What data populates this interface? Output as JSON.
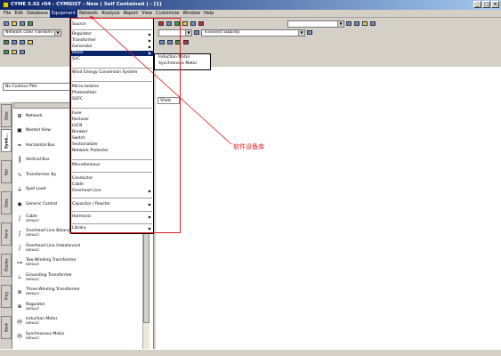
{
  "window": {
    "title": "CYME 5.02 r04 - CYMDIST - New ( Self Contained ) - [1]",
    "min": "_",
    "max": "□",
    "close": "×"
  },
  "menubar": [
    "File",
    "Edit",
    "Database",
    "Equipment",
    "Network",
    "Analysis",
    "Report",
    "View",
    "Customize",
    "Window",
    "Help"
  ],
  "toolbar": {
    "network_color": "Network color (random)",
    "transient": "Transient Stability"
  },
  "contour": "No Contour Plot",
  "view_tab": "View",
  "tabs": [
    "Data",
    "Symb...",
    "Net",
    "Data",
    "Anno",
    "Display",
    "Prog",
    "Book"
  ],
  "equipment_menu": {
    "items": [
      {
        "label": "Source",
        "sub": false
      },
      {
        "label": "Regulator",
        "sub": true
      },
      {
        "label": "Transformer",
        "sub": true
      },
      {
        "label": "Generator",
        "sub": true
      },
      {
        "label": "Motor",
        "sub": true,
        "highlight": true
      },
      {
        "label": "SVC",
        "sub": false
      },
      {
        "label": "Wind Energy Conversion System",
        "sub": false
      },
      {
        "label": "Micro-turbine",
        "sub": false
      },
      {
        "label": "Photovoltaic",
        "sub": false
      },
      {
        "label": "SOFC",
        "sub": false
      },
      {
        "label": "Fuse",
        "sub": false
      },
      {
        "label": "Recloser",
        "sub": false
      },
      {
        "label": "LVCB",
        "sub": false
      },
      {
        "label": "Breaker",
        "sub": false
      },
      {
        "label": "Switch",
        "sub": false
      },
      {
        "label": "Sectionalizer",
        "sub": false
      },
      {
        "label": "Network Protector",
        "sub": false
      },
      {
        "label": "Miscellaneous",
        "sub": false
      },
      {
        "label": "Conductor",
        "sub": false
      },
      {
        "label": "Cable",
        "sub": false
      },
      {
        "label": "Overhead Line",
        "sub": true
      },
      {
        "label": "Capacitor / Reactor",
        "sub": true
      },
      {
        "label": "Harmonic",
        "sub": true
      },
      {
        "label": "Library",
        "sub": true
      }
    ]
  },
  "motor_submenu": [
    "Induction Motor",
    "Synchronous Motor"
  ],
  "annotation": "软件设备库",
  "equipment_list": [
    {
      "label": "Network",
      "sub": ""
    },
    {
      "label": "Nested View",
      "sub": ""
    },
    {
      "label": "Horizontal Bus",
      "sub": ""
    },
    {
      "label": "Vertical Bus",
      "sub": ""
    },
    {
      "label": "Transformer By",
      "sub": ""
    },
    {
      "label": "Spot Load",
      "sub": ""
    },
    {
      "label": "Generic Control",
      "sub": ""
    },
    {
      "label": "Cable",
      "sub": "DEFAULT"
    },
    {
      "label": "Overhead Line Balanced",
      "sub": "DEFAULT"
    },
    {
      "label": "Overhead Line Unbalanced",
      "sub": "DEFAULT"
    },
    {
      "label": "Two-Winding Transformer",
      "sub": "DEFAULT"
    },
    {
      "label": "Grounding Transformer",
      "sub": "DEFAULT"
    },
    {
      "label": "Three-Winding Transformer",
      "sub": "DEFAULT"
    },
    {
      "label": "Regulator",
      "sub": "DEFAULT"
    },
    {
      "label": "Induction Motor",
      "sub": "DEFAULT"
    },
    {
      "label": "Synchronous Motor",
      "sub": "DEFAULT"
    }
  ],
  "icons": {
    "network": "network-icon",
    "nested": "nested-view-icon",
    "hbus": "horizontal-bus-icon",
    "vbus": "vertical-bus-icon",
    "xfmr": "transformer-icon",
    "load": "spot-load-icon",
    "control": "generic-control-icon",
    "line": "line-icon",
    "motor": "motor-icon"
  },
  "colors": {
    "annotation": "#e02020",
    "highlight": "#0a246a",
    "title_gradient_start": "#0a246a",
    "title_gradient_end": "#a6caf0"
  }
}
